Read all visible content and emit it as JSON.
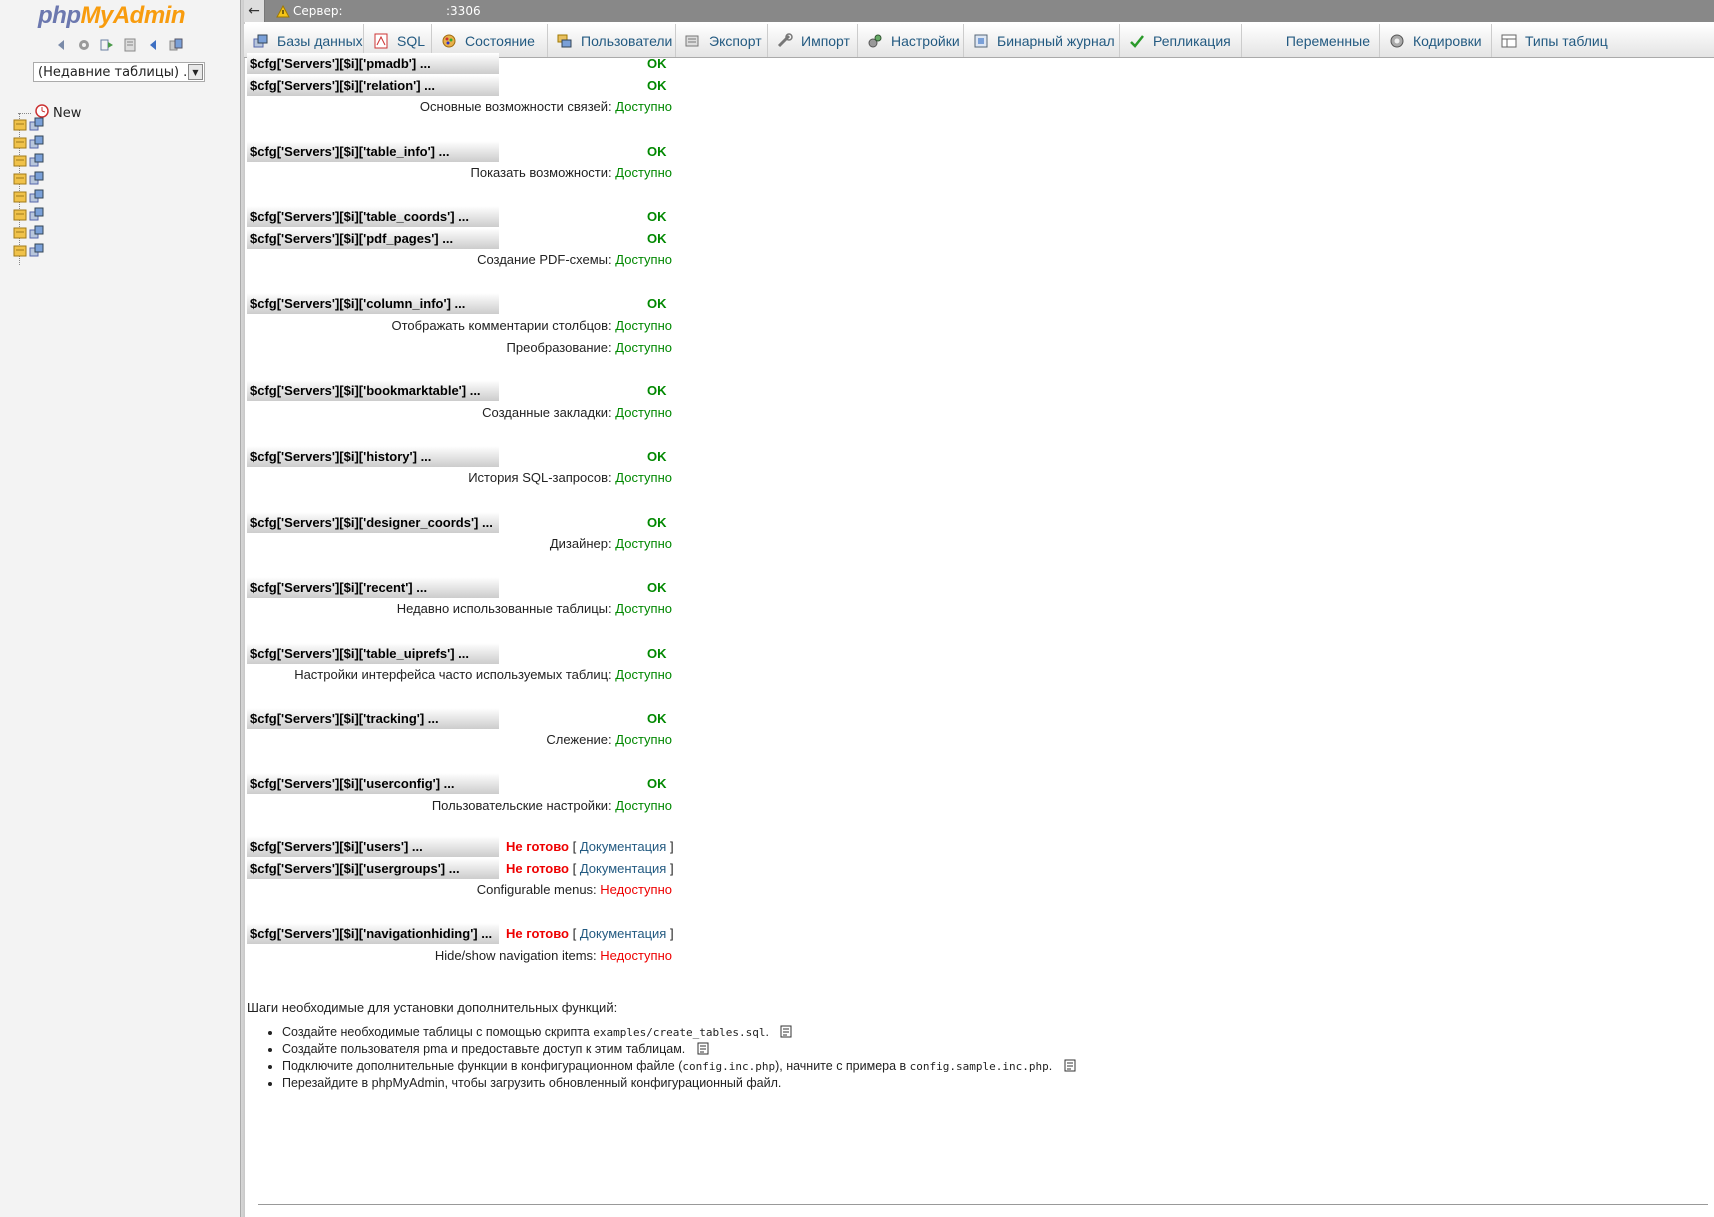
{
  "nav": {
    "logo_php": "php",
    "logo_myadmin": "MyAdmin",
    "recent_tables": "(Недавние таблицы) ...",
    "tree_new": "New"
  },
  "topbar": {
    "back": "←",
    "server_label": "Сервер:",
    "server_port": ":3306"
  },
  "tabs": [
    {
      "label": "Базы данных",
      "icon": "database-icon"
    },
    {
      "label": "SQL",
      "icon": "sql-icon"
    },
    {
      "label": "Состояние",
      "icon": "status-icon"
    },
    {
      "label": "Пользователи",
      "icon": "users-icon"
    },
    {
      "label": "Экспорт",
      "icon": "export-icon"
    },
    {
      "label": "Импорт",
      "icon": "import-icon"
    },
    {
      "label": "Настройки",
      "icon": "settings-icon"
    },
    {
      "label": "Бинарный журнал",
      "icon": "binlog-icon"
    },
    {
      "label": "Репликация",
      "icon": "replication-icon"
    },
    {
      "label": "Переменные",
      "icon": ""
    },
    {
      "label": "Кодировки",
      "icon": "charset-icon"
    },
    {
      "label": "Типы таблиц",
      "icon": "engines-icon"
    }
  ],
  "rows": {
    "pmadb": {
      "label": "$cfg['Servers'][$i]['pmadb'] ...",
      "status": "OK"
    },
    "relation": {
      "label": "$cfg['Servers'][$i]['relation'] ...",
      "status": "OK"
    },
    "table_info": {
      "label": "$cfg['Servers'][$i]['table_info'] ...",
      "status": "OK"
    },
    "table_coords": {
      "label": "$cfg['Servers'][$i]['table_coords'] ...",
      "status": "OK"
    },
    "pdf_pages": {
      "label": "$cfg['Servers'][$i]['pdf_pages'] ...",
      "status": "OK"
    },
    "column_info": {
      "label": "$cfg['Servers'][$i]['column_info'] ...",
      "status": "OK"
    },
    "bookmarktable": {
      "label": "$cfg['Servers'][$i]['bookmarktable'] ...",
      "status": "OK"
    },
    "history": {
      "label": "$cfg['Servers'][$i]['history'] ...",
      "status": "OK"
    },
    "designer_coords": {
      "label": "$cfg['Servers'][$i]['designer_coords'] ...",
      "status": "OK"
    },
    "recent": {
      "label": "$cfg['Servers'][$i]['recent'] ...",
      "status": "OK"
    },
    "table_uiprefs": {
      "label": "$cfg['Servers'][$i]['table_uiprefs'] ...",
      "status": "OK"
    },
    "tracking": {
      "label": "$cfg['Servers'][$i]['tracking'] ...",
      "status": "OK"
    },
    "userconfig": {
      "label": "$cfg['Servers'][$i]['userconfig'] ...",
      "status": "OK"
    },
    "users": {
      "label": "$cfg['Servers'][$i]['users'] ...",
      "status": "Не готово",
      "doc": "Документация"
    },
    "usergroups": {
      "label": "$cfg['Servers'][$i]['usergroups'] ...",
      "status": "Не готово",
      "doc": "Документация"
    },
    "navigationhiding": {
      "label": "$cfg['Servers'][$i]['navigationhiding'] ...",
      "status": "Не готово",
      "doc": "Документация"
    }
  },
  "features": {
    "relations": {
      "label": "Основные возможности связей:",
      "value": "Доступно"
    },
    "display": {
      "label": "Показать возможности:",
      "value": "Доступно"
    },
    "pdf": {
      "label": "Создание PDF-схемы:",
      "value": "Доступно"
    },
    "comments": {
      "label": "Отображать комментарии столбцов:",
      "value": "Доступно"
    },
    "transformation": {
      "label": "Преобразование:",
      "value": "Доступно"
    },
    "bookmarks": {
      "label": "Созданные закладки:",
      "value": "Доступно"
    },
    "history": {
      "label": "История SQL-запросов:",
      "value": "Доступно"
    },
    "designer": {
      "label": "Дизайнер:",
      "value": "Доступно"
    },
    "recent": {
      "label": "Недавно использованные таблицы:",
      "value": "Доступно"
    },
    "uiprefs": {
      "label": "Настройки интерфейса часто используемых таблиц:",
      "value": "Доступно"
    },
    "tracking": {
      "label": "Слежение:",
      "value": "Доступно"
    },
    "userprefs": {
      "label": "Пользовательские настройки:",
      "value": "Доступно"
    },
    "menus": {
      "label": "Configurable menus:",
      "value": "Недоступно"
    },
    "navhiding": {
      "label": "Hide/show navigation items:",
      "value": "Недоступно"
    }
  },
  "steps": {
    "title": "Шаги необходимые для установки дополнительных функций:",
    "s1_text": "Создайте необходимые таблицы с помощью скрипта",
    "s1_code": "examples/create_tables.sql",
    "s2_text": "Создайте пользователя pma и предоставьте доступ к этим таблицам.",
    "s3_a": "Подключите дополнительные функции в конфигурационном файле (",
    "s3_code1": "config.inc.php",
    "s3_b": "), начните с примера в",
    "s3_code2": "config.sample.inc.php",
    "s4_text": "Перезайдите в phpMyAdmin, чтобы загрузить обновленный конфигурационный файл."
  },
  "colors": {
    "ok": "#008800",
    "not_ready": "#ee0000",
    "link": "#235a81"
  }
}
